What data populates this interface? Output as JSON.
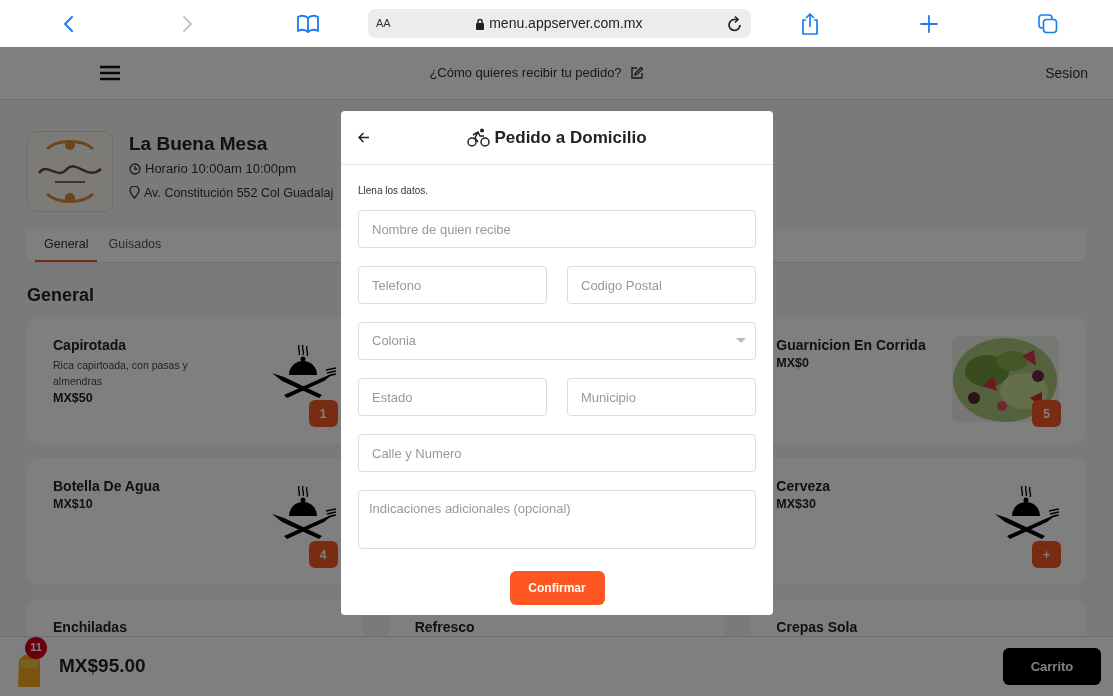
{
  "browser": {
    "nav": [
      {
        "kind": "back",
        "disabled": false
      },
      {
        "kind": "forward",
        "disabled": true
      }
    ],
    "text_size": "AA",
    "url": "menu.appserver.com.mx"
  },
  "header": {
    "prompt": "¿Cómo quieres recibir tu pedido?",
    "login": "Sesion"
  },
  "store": {
    "name": "La Buena Mesa",
    "hours": "Horario 10:00am 10:00pm",
    "address": "Av. Constitución 552 Col Guadalaj"
  },
  "tabs": [
    {
      "label": "General",
      "selected": true
    },
    {
      "label": "Guisados",
      "selected": false
    }
  ],
  "section_title": "General",
  "menu_columns": [
    {
      "items": [
        {
          "name": "Capirotada",
          "description": "Rica capirtoada, con pasas y almendras",
          "price": "MX$50",
          "kind": "dish",
          "badge": "1"
        },
        {
          "name": "Botella De Agua",
          "price": "MX$10",
          "kind": "dish",
          "badge": "4"
        },
        {
          "name": "Enchiladas"
        }
      ]
    },
    {
      "items": [
        {
          "name": "Refresco"
        }
      ]
    },
    {
      "items": [
        {
          "name": "Guarnicion En Corrida",
          "price": "MX$0",
          "kind": "picture",
          "badge": "5"
        },
        {
          "name": "Cerveza",
          "price": "MX$30",
          "kind": "dish",
          "badge": "+"
        },
        {
          "name": "Crepas Sola"
        }
      ]
    }
  ],
  "cart": {
    "count": "11",
    "total": "MX$95.00",
    "button": "Carrito"
  },
  "modal": {
    "title": "Pedido a Domicilio",
    "instructions": "Llena los datos.",
    "rows": [
      {
        "fields": [
          {
            "kind": "text",
            "placeholder": "Nombre de quien recibe"
          }
        ]
      },
      {
        "fields": [
          {
            "kind": "text",
            "placeholder": "Telefono"
          },
          {
            "kind": "text",
            "placeholder": "Codigo Postal"
          }
        ]
      },
      {
        "fields": [
          {
            "kind": "select",
            "placeholder": "Colonia"
          }
        ]
      },
      {
        "fields": [
          {
            "kind": "text",
            "placeholder": "Estado"
          },
          {
            "kind": "text",
            "placeholder": "Municipio"
          }
        ]
      },
      {
        "fields": [
          {
            "kind": "text",
            "placeholder": "Calle y Numero"
          }
        ]
      },
      {
        "fields": [
          {
            "kind": "textarea",
            "placeholder": "Indicaciones adicionales (opcional)"
          }
        ]
      }
    ],
    "confirm": "Confirmar"
  }
}
